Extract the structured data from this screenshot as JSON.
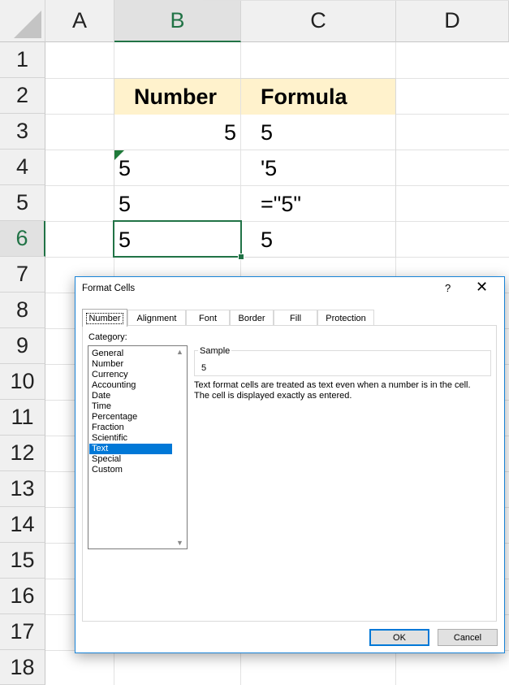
{
  "sheet": {
    "columns": [
      "A",
      "B",
      "C",
      "D"
    ],
    "active_column": "B",
    "rows": [
      "1",
      "2",
      "3",
      "4",
      "5",
      "6",
      "7",
      "8",
      "9",
      "10",
      "11",
      "12",
      "13",
      "14",
      "15",
      "16",
      "17",
      "18"
    ],
    "active_row": "6",
    "table": {
      "headers": [
        "Number",
        "Formula"
      ],
      "rows": [
        [
          "5",
          "5"
        ],
        [
          "5",
          "'5"
        ],
        [
          "5",
          "=\"5\""
        ],
        [
          "5",
          "5"
        ]
      ]
    },
    "colors": {
      "accent": "#217346",
      "header_fill": "#fff2cc"
    }
  },
  "dialog": {
    "title": "Format Cells",
    "help": "?",
    "close": "✕",
    "tabs": [
      "Number",
      "Alignment",
      "Font",
      "Border",
      "Fill",
      "Protection"
    ],
    "active_tab": "Number",
    "category_label": "Category:",
    "categories": [
      "General",
      "Number",
      "Currency",
      "Accounting",
      "Date",
      "Time",
      "Percentage",
      "Fraction",
      "Scientific",
      "Text",
      "Special",
      "Custom"
    ],
    "selected_category": "Text",
    "sample_label": "Sample",
    "sample_value": "5",
    "description_line1": "Text format cells are treated as text even when a number is in the cell.",
    "description_line2": "The cell is displayed exactly as entered.",
    "ok_label": "OK",
    "cancel_label": "Cancel"
  }
}
